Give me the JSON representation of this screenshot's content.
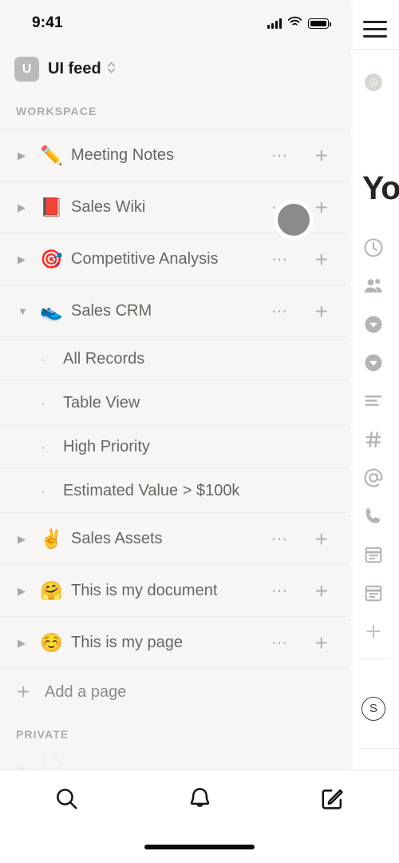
{
  "status_bar": {
    "time": "9:41",
    "signal_icon": "cellular-bars-icon",
    "wifi_icon": "wifi-icon",
    "battery_icon": "battery-full-icon"
  },
  "workspace_switcher": {
    "badge_letter": "U",
    "name": "UI feed",
    "chevron_icon": "chevron-up-down-icon",
    "badge_color": "#bcbab6"
  },
  "sidebar": {
    "background": "#f7f6f4",
    "sections": [
      {
        "label": "WORKSPACE",
        "items": [
          {
            "emoji": "✏️",
            "label": "Meeting Notes",
            "expanded": false,
            "toggle_icon": "triangle-right-icon",
            "more_icon": "more-horizontal-icon",
            "add_icon": "plus-icon"
          },
          {
            "emoji": "📕",
            "label": "Sales Wiki",
            "expanded": false,
            "toggle_icon": "triangle-right-icon",
            "more_icon": "more-horizontal-icon",
            "add_icon": "plus-icon"
          },
          {
            "emoji": "🎯",
            "label": "Competitive Analysis",
            "expanded": false,
            "toggle_icon": "triangle-right-icon",
            "more_icon": "more-horizontal-icon",
            "add_icon": "plus-icon"
          },
          {
            "emoji": "👟",
            "label": "Sales CRM",
            "expanded": true,
            "toggle_icon": "triangle-down-icon",
            "more_icon": "more-horizontal-icon",
            "add_icon": "plus-icon",
            "children": [
              {
                "bullet": "·",
                "label": "All Records"
              },
              {
                "bullet": "·",
                "label": "Table View"
              },
              {
                "bullet": "·",
                "label": "High Priority"
              },
              {
                "bullet": "·",
                "label": "Estimated Value > $100k"
              }
            ]
          },
          {
            "emoji": "✌️",
            "label": "Sales Assets",
            "expanded": false,
            "toggle_icon": "triangle-right-icon",
            "more_icon": "more-horizontal-icon",
            "add_icon": "plus-icon"
          },
          {
            "emoji": "🤗",
            "label": "This is my document",
            "expanded": false,
            "toggle_icon": "triangle-right-icon",
            "more_icon": "more-horizontal-icon",
            "add_icon": "plus-icon"
          },
          {
            "emoji": "☺️",
            "label": "This is my page",
            "expanded": false,
            "toggle_icon": "triangle-right-icon",
            "more_icon": "more-horizontal-icon",
            "add_icon": "plus-icon"
          }
        ],
        "add_page_label": "Add a page",
        "add_page_icon": "plus-icon"
      },
      {
        "label": "PRIVATE",
        "items": []
      }
    ]
  },
  "page_panel": {
    "menu_icon": "hamburger-menu-icon",
    "emoji_button_icon": "smiley-face-icon",
    "title": "Yo",
    "properties": [
      {
        "icon": "clock-icon"
      },
      {
        "icon": "people-icon"
      },
      {
        "icon": "chevron-down-circle-icon"
      },
      {
        "icon": "chevron-down-circle-icon"
      },
      {
        "icon": "text-lines-icon"
      },
      {
        "icon": "hash-icon"
      },
      {
        "icon": "at-sign-icon"
      },
      {
        "icon": "phone-icon"
      },
      {
        "icon": "calendar-icon"
      },
      {
        "icon": "calendar-icon"
      },
      {
        "icon": "plus-icon"
      }
    ],
    "avatar_letter": "S"
  },
  "bottom_nav": {
    "items": [
      {
        "icon": "search-icon",
        "label": "Search"
      },
      {
        "icon": "bell-icon",
        "label": "Notifications"
      },
      {
        "icon": "compose-icon",
        "label": "New page"
      }
    ]
  },
  "touch_indicator": {
    "name": "touch-point",
    "color": "#8b8b8b"
  }
}
